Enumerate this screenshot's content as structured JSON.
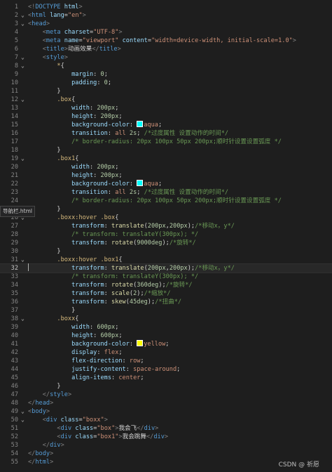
{
  "tooltip": "导航栏.html",
  "watermark": "CSDN @ 祈愿",
  "cursor_line": 32,
  "lines": [
    {
      "n": "1",
      "t": [
        [
          "k-brk",
          "<!"
        ],
        [
          "k-dt",
          "DOCTYPE"
        ],
        [
          "k-txt",
          " "
        ],
        [
          "k-attr",
          "html"
        ],
        [
          "k-brk",
          ">"
        ]
      ]
    },
    {
      "n": "2",
      "t": [
        [
          "k-brk",
          "<"
        ],
        [
          "k-tag",
          "html"
        ],
        [
          "k-txt",
          " "
        ],
        [
          "k-attr",
          "lang"
        ],
        [
          "k-txt",
          "="
        ],
        [
          "k-str",
          "\"en\""
        ],
        [
          "k-brk",
          ">"
        ]
      ]
    },
    {
      "n": "3",
      "t": [
        [
          "k-brk",
          "<"
        ],
        [
          "k-tag",
          "head"
        ],
        [
          "k-brk",
          ">"
        ]
      ]
    },
    {
      "n": "4",
      "t": [
        [
          "k-txt",
          "    "
        ],
        [
          "k-brk",
          "<"
        ],
        [
          "k-tag",
          "meta"
        ],
        [
          "k-txt",
          " "
        ],
        [
          "k-attr",
          "charset"
        ],
        [
          "k-txt",
          "="
        ],
        [
          "k-str",
          "\"UTF-8\""
        ],
        [
          "k-brk",
          ">"
        ]
      ]
    },
    {
      "n": "5",
      "t": [
        [
          "k-txt",
          "    "
        ],
        [
          "k-brk",
          "<"
        ],
        [
          "k-tag",
          "meta"
        ],
        [
          "k-txt",
          " "
        ],
        [
          "k-attr",
          "name"
        ],
        [
          "k-txt",
          "="
        ],
        [
          "k-str",
          "\"viewport\""
        ],
        [
          "k-txt",
          " "
        ],
        [
          "k-attr",
          "content"
        ],
        [
          "k-txt",
          "="
        ],
        [
          "k-str",
          "\"width=device-width, initial-scale=1.0\""
        ],
        [
          "k-brk",
          ">"
        ]
      ]
    },
    {
      "n": "6",
      "t": [
        [
          "k-txt",
          "    "
        ],
        [
          "k-brk",
          "<"
        ],
        [
          "k-tag",
          "title"
        ],
        [
          "k-brk",
          ">"
        ],
        [
          "k-txt",
          "动画效果"
        ],
        [
          "k-brk",
          "</"
        ],
        [
          "k-tag",
          "title"
        ],
        [
          "k-brk",
          ">"
        ]
      ]
    },
    {
      "n": "7",
      "t": [
        [
          "k-txt",
          "    "
        ],
        [
          "k-brk",
          "<"
        ],
        [
          "k-tag",
          "style"
        ],
        [
          "k-brk",
          ">"
        ]
      ]
    },
    {
      "n": "8",
      "t": [
        [
          "k-txt",
          "        "
        ],
        [
          "k-sel",
          "*"
        ],
        [
          "k-txt",
          "{"
        ]
      ]
    },
    {
      "n": "9",
      "t": [
        [
          "k-txt",
          "            "
        ],
        [
          "k-prop",
          "margin"
        ],
        [
          "k-txt",
          ": "
        ],
        [
          "k-num",
          "0"
        ],
        [
          "k-txt",
          ";"
        ]
      ]
    },
    {
      "n": "10",
      "t": [
        [
          "k-txt",
          "            "
        ],
        [
          "k-prop",
          "padding"
        ],
        [
          "k-txt",
          ": "
        ],
        [
          "k-num",
          "0"
        ],
        [
          "k-txt",
          ";"
        ]
      ]
    },
    {
      "n": "11",
      "t": [
        [
          "k-txt",
          "        }"
        ]
      ]
    },
    {
      "n": "12",
      "t": [
        [
          "k-txt",
          "        "
        ],
        [
          "k-sel",
          ".box"
        ],
        [
          "k-txt",
          "{"
        ]
      ]
    },
    {
      "n": "13",
      "t": [
        [
          "k-txt",
          "            "
        ],
        [
          "k-prop",
          "width"
        ],
        [
          "k-txt",
          ": "
        ],
        [
          "k-num",
          "200px"
        ],
        [
          "k-txt",
          ";"
        ]
      ]
    },
    {
      "n": "14",
      "t": [
        [
          "k-txt",
          "            "
        ],
        [
          "k-prop",
          "height"
        ],
        [
          "k-txt",
          ": "
        ],
        [
          "k-num",
          "200px"
        ],
        [
          "k-txt",
          ";"
        ]
      ]
    },
    {
      "n": "15",
      "t": [
        [
          "k-txt",
          "            "
        ],
        [
          "k-prop",
          "background-color"
        ],
        [
          "k-txt",
          ": "
        ],
        [
          "sw",
          "#00ffff"
        ],
        [
          "k-val",
          "aqua"
        ],
        [
          "k-txt",
          ";"
        ]
      ]
    },
    {
      "n": "16",
      "t": [
        [
          "k-txt",
          "            "
        ],
        [
          "k-prop",
          "transition"
        ],
        [
          "k-txt",
          ": "
        ],
        [
          "k-val",
          "all"
        ],
        [
          "k-txt",
          " "
        ],
        [
          "k-num",
          "2s"
        ],
        [
          "k-txt",
          "; "
        ],
        [
          "k-com",
          "/*过度属性 设置动作的时间*/"
        ]
      ]
    },
    {
      "n": "17",
      "t": [
        [
          "k-txt",
          "            "
        ],
        [
          "k-com",
          "/* border-radius: 20px 100px 50px 200px;顺时针设置设置弧度 */"
        ]
      ]
    },
    {
      "n": "18",
      "t": [
        [
          "k-txt",
          "        }"
        ]
      ]
    },
    {
      "n": "19",
      "t": [
        [
          "k-txt",
          "        "
        ],
        [
          "k-sel",
          ".box1"
        ],
        [
          "k-txt",
          "{"
        ]
      ]
    },
    {
      "n": "20",
      "t": [
        [
          "k-txt",
          "            "
        ],
        [
          "k-prop",
          "width"
        ],
        [
          "k-txt",
          ": "
        ],
        [
          "k-num",
          "200px"
        ],
        [
          "k-txt",
          ";"
        ]
      ]
    },
    {
      "n": "21",
      "t": [
        [
          "k-txt",
          "            "
        ],
        [
          "k-prop",
          "height"
        ],
        [
          "k-txt",
          ": "
        ],
        [
          "k-num",
          "200px"
        ],
        [
          "k-txt",
          ";"
        ]
      ]
    },
    {
      "n": "22",
      "t": [
        [
          "k-txt",
          "            "
        ],
        [
          "k-prop",
          "background-color"
        ],
        [
          "k-txt",
          ": "
        ],
        [
          "sw",
          "#00ffff"
        ],
        [
          "k-val",
          "aqua"
        ],
        [
          "k-txt",
          ";"
        ]
      ]
    },
    {
      "n": "23",
      "t": [
        [
          "k-txt",
          "            "
        ],
        [
          "k-prop",
          "transition"
        ],
        [
          "k-txt",
          ": "
        ],
        [
          "k-val",
          "all"
        ],
        [
          "k-txt",
          " "
        ],
        [
          "k-num",
          "2s"
        ],
        [
          "k-txt",
          "; "
        ],
        [
          "k-com",
          "/*过度属性 设置动作的时间*/"
        ]
      ]
    },
    {
      "n": "24",
      "t": [
        [
          "k-txt",
          "            "
        ],
        [
          "k-com",
          "/* border-radius: 20px 100px 50px 200px;顺时针设置设置弧度 */"
        ]
      ]
    },
    {
      "n": "25",
      "t": [
        [
          "k-txt",
          "        }"
        ]
      ]
    },
    {
      "n": "26",
      "t": [
        [
          "k-txt",
          "        "
        ],
        [
          "k-sel",
          ".boxx:hover .box"
        ],
        [
          "k-txt",
          "{"
        ]
      ]
    },
    {
      "n": "27",
      "t": [
        [
          "k-txt",
          "            "
        ],
        [
          "k-prop",
          "transform"
        ],
        [
          "k-txt",
          ": "
        ],
        [
          "k-fn",
          "translate"
        ],
        [
          "k-txt",
          "("
        ],
        [
          "k-num",
          "200px"
        ],
        [
          "k-txt",
          ","
        ],
        [
          "k-num",
          "200px"
        ],
        [
          "k-txt",
          ");"
        ],
        [
          "k-com",
          "/*移动x，y*/"
        ]
      ]
    },
    {
      "n": "28",
      "t": [
        [
          "k-txt",
          "            "
        ],
        [
          "k-com",
          "/* transform: translateY(300px); */"
        ]
      ]
    },
    {
      "n": "29",
      "t": [
        [
          "k-txt",
          "            "
        ],
        [
          "k-prop",
          "transform"
        ],
        [
          "k-txt",
          ": "
        ],
        [
          "k-fn",
          "rotate"
        ],
        [
          "k-txt",
          "("
        ],
        [
          "k-num",
          "9000deg"
        ],
        [
          "k-txt",
          ");"
        ],
        [
          "k-com",
          "/*旋转*/"
        ]
      ]
    },
    {
      "n": "30",
      "t": [
        [
          "k-txt",
          "        }"
        ]
      ]
    },
    {
      "n": "31",
      "t": [
        [
          "k-txt",
          "        "
        ],
        [
          "k-sel",
          ".boxx:hover .box1"
        ],
        [
          "k-txt",
          "{"
        ]
      ]
    },
    {
      "n": "32",
      "t": [
        [
          "k-txt",
          "            "
        ],
        [
          "k-prop",
          "transform"
        ],
        [
          "k-txt",
          ": "
        ],
        [
          "k-fn",
          "translate"
        ],
        [
          "k-txt",
          "("
        ],
        [
          "k-num",
          "200px"
        ],
        [
          "k-txt",
          ","
        ],
        [
          "k-num",
          "200px"
        ],
        [
          "k-txt",
          ");"
        ],
        [
          "k-com",
          "/*移动x，y*/"
        ]
      ]
    },
    {
      "n": "33",
      "t": [
        [
          "k-txt",
          "            "
        ],
        [
          "k-com",
          "/* transform: translateY(300px); */"
        ]
      ]
    },
    {
      "n": "34",
      "t": [
        [
          "k-txt",
          "            "
        ],
        [
          "k-prop",
          "transform"
        ],
        [
          "k-txt",
          ": "
        ],
        [
          "k-fn",
          "rotate"
        ],
        [
          "k-txt",
          "("
        ],
        [
          "k-num",
          "360deg"
        ],
        [
          "k-txt",
          ");"
        ],
        [
          "k-com",
          "/*旋转*/"
        ]
      ]
    },
    {
      "n": "35",
      "t": [
        [
          "k-txt",
          "            "
        ],
        [
          "k-prop",
          "transform"
        ],
        [
          "k-txt",
          ": "
        ],
        [
          "k-fn",
          "scale"
        ],
        [
          "k-txt",
          "("
        ],
        [
          "k-num",
          "2"
        ],
        [
          "k-txt",
          ");"
        ],
        [
          "k-com",
          "/*缩放*/"
        ]
      ]
    },
    {
      "n": "36",
      "t": [
        [
          "k-txt",
          "            "
        ],
        [
          "k-prop",
          "transform"
        ],
        [
          "k-txt",
          ": "
        ],
        [
          "k-fn",
          "skew"
        ],
        [
          "k-txt",
          "("
        ],
        [
          "k-num",
          "45deg"
        ],
        [
          "k-txt",
          ");"
        ],
        [
          "k-com",
          "/*扭曲*/"
        ]
      ]
    },
    {
      "n": "37",
      "t": [
        [
          "k-txt",
          "            }"
        ]
      ]
    },
    {
      "n": "38",
      "t": [
        [
          "k-txt",
          "        "
        ],
        [
          "k-sel",
          ".boxx"
        ],
        [
          "k-txt",
          "{"
        ]
      ]
    },
    {
      "n": "39",
      "t": [
        [
          "k-txt",
          "            "
        ],
        [
          "k-prop",
          "width"
        ],
        [
          "k-txt",
          ": "
        ],
        [
          "k-num",
          "600px"
        ],
        [
          "k-txt",
          ";"
        ]
      ]
    },
    {
      "n": "40",
      "t": [
        [
          "k-txt",
          "            "
        ],
        [
          "k-prop",
          "height"
        ],
        [
          "k-txt",
          ": "
        ],
        [
          "k-num",
          "600px"
        ],
        [
          "k-txt",
          ";"
        ]
      ]
    },
    {
      "n": "41",
      "t": [
        [
          "k-txt",
          "            "
        ],
        [
          "k-prop",
          "background-color"
        ],
        [
          "k-txt",
          ": "
        ],
        [
          "sw",
          "#ffff00"
        ],
        [
          "k-val",
          "yellow"
        ],
        [
          "k-txt",
          ";"
        ]
      ]
    },
    {
      "n": "42",
      "t": [
        [
          "k-txt",
          "            "
        ],
        [
          "k-prop",
          "display"
        ],
        [
          "k-txt",
          ": "
        ],
        [
          "k-val",
          "flex"
        ],
        [
          "k-txt",
          ";"
        ]
      ]
    },
    {
      "n": "43",
      "t": [
        [
          "k-txt",
          "            "
        ],
        [
          "k-prop",
          "flex-direction"
        ],
        [
          "k-txt",
          ": "
        ],
        [
          "k-val",
          "row"
        ],
        [
          "k-txt",
          ";"
        ]
      ]
    },
    {
      "n": "44",
      "t": [
        [
          "k-txt",
          "            "
        ],
        [
          "k-prop",
          "justify-content"
        ],
        [
          "k-txt",
          ": "
        ],
        [
          "k-val",
          "space-around"
        ],
        [
          "k-txt",
          ";"
        ]
      ]
    },
    {
      "n": "45",
      "t": [
        [
          "k-txt",
          "            "
        ],
        [
          "k-prop",
          "align-items"
        ],
        [
          "k-txt",
          ": "
        ],
        [
          "k-val",
          "center"
        ],
        [
          "k-txt",
          ";"
        ]
      ]
    },
    {
      "n": "46",
      "t": [
        [
          "k-txt",
          "        }"
        ]
      ]
    },
    {
      "n": "47",
      "t": [
        [
          "k-txt",
          "    "
        ],
        [
          "k-brk",
          "</"
        ],
        [
          "k-tag",
          "style"
        ],
        [
          "k-brk",
          ">"
        ]
      ]
    },
    {
      "n": "48",
      "t": [
        [
          "k-brk",
          "</"
        ],
        [
          "k-tag",
          "head"
        ],
        [
          "k-brk",
          ">"
        ]
      ]
    },
    {
      "n": "49",
      "t": [
        [
          "k-brk",
          "<"
        ],
        [
          "k-tag",
          "body"
        ],
        [
          "k-brk",
          ">"
        ]
      ]
    },
    {
      "n": "50",
      "t": [
        [
          "k-txt",
          "    "
        ],
        [
          "k-brk",
          "<"
        ],
        [
          "k-tag",
          "div"
        ],
        [
          "k-txt",
          " "
        ],
        [
          "k-attr",
          "class"
        ],
        [
          "k-txt",
          "="
        ],
        [
          "k-str",
          "\"boxx\""
        ],
        [
          "k-brk",
          ">"
        ]
      ]
    },
    {
      "n": "51",
      "t": [
        [
          "k-txt",
          "        "
        ],
        [
          "k-brk",
          "<"
        ],
        [
          "k-tag",
          "div"
        ],
        [
          "k-txt",
          " "
        ],
        [
          "k-attr",
          "class"
        ],
        [
          "k-txt",
          "="
        ],
        [
          "k-str",
          "\"box\""
        ],
        [
          "k-brk",
          ">"
        ],
        [
          "k-txt",
          "我会飞"
        ],
        [
          "k-brk",
          "</"
        ],
        [
          "k-tag",
          "div"
        ],
        [
          "k-brk",
          ">"
        ]
      ]
    },
    {
      "n": "52",
      "t": [
        [
          "k-txt",
          "        "
        ],
        [
          "k-brk",
          "<"
        ],
        [
          "k-tag",
          "div"
        ],
        [
          "k-txt",
          " "
        ],
        [
          "k-attr",
          "class"
        ],
        [
          "k-txt",
          "="
        ],
        [
          "k-str",
          "\"box1\""
        ],
        [
          "k-brk",
          ">"
        ],
        [
          "k-txt",
          "我会跳舞"
        ],
        [
          "k-brk",
          "</"
        ],
        [
          "k-tag",
          "div"
        ],
        [
          "k-brk",
          ">"
        ]
      ]
    },
    {
      "n": "53",
      "t": [
        [
          "k-txt",
          "    "
        ],
        [
          "k-brk",
          "</"
        ],
        [
          "k-tag",
          "div"
        ],
        [
          "k-brk",
          ">"
        ]
      ]
    },
    {
      "n": "54",
      "t": [
        [
          "k-brk",
          "</"
        ],
        [
          "k-tag",
          "body"
        ],
        [
          "k-brk",
          ">"
        ]
      ]
    },
    {
      "n": "55",
      "t": [
        [
          "k-brk",
          "</"
        ],
        [
          "k-tag",
          "html"
        ],
        [
          "k-brk",
          ">"
        ]
      ]
    }
  ]
}
